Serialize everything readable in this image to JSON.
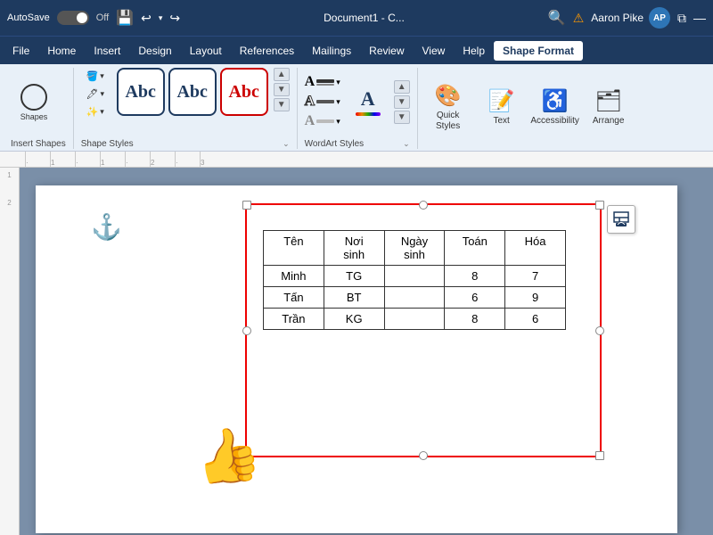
{
  "titlebar": {
    "autosave_label": "AutoSave",
    "toggle_state": "Off",
    "save_icon": "💾",
    "undo_icon": "↩",
    "redo_icon": "↪",
    "doc_title": "Document1 - C...",
    "search_icon": "🔍",
    "warning_icon": "⚠",
    "user_name": "Aaron Pike",
    "avatar_initials": "AP",
    "window_icon": "⧉",
    "minimize_icon": "—"
  },
  "menubar": {
    "items": [
      "File",
      "Home",
      "Insert",
      "Design",
      "Layout",
      "References",
      "Mailings",
      "Review",
      "View",
      "Help",
      "Shape Format"
    ]
  },
  "ribbon": {
    "insert_shapes_label": "Insert Shapes",
    "shape_styles_label": "Shape Styles",
    "shape_styles_expand": "⌄",
    "wordart_styles_label": "WordArt Styles",
    "wordart_styles_expand": "⌄",
    "abc_boxes": [
      {
        "label": "Abc",
        "style": "dark"
      },
      {
        "label": "Abc",
        "style": "outline"
      },
      {
        "label": "Abc",
        "style": "red-border"
      }
    ],
    "quick_styles_label": "Quick\nStyles",
    "text_label": "Text",
    "accessibility_label": "Accessibility",
    "arrange_label": "Arrange"
  },
  "table": {
    "headers": [
      "Tên",
      "Nơi sinh",
      "Ngày sinh",
      "Toán",
      "Hóa"
    ],
    "rows": [
      [
        "Minh",
        "TG",
        "",
        "8",
        "7"
      ],
      [
        "Tấn",
        "BT",
        "",
        "6",
        "9"
      ],
      [
        "Trần",
        "KG",
        "",
        "8",
        "6"
      ]
    ]
  },
  "ruler": {
    "marks": [
      "",
      "1",
      "",
      "1",
      "",
      "2",
      "",
      "3"
    ]
  }
}
